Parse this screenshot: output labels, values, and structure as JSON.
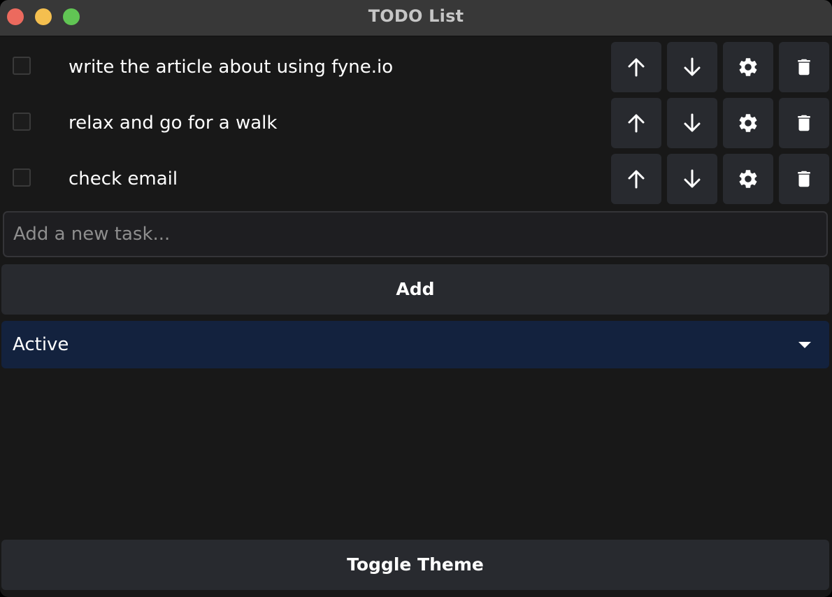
{
  "window": {
    "title": "TODO List"
  },
  "tasks": [
    {
      "label": "write the article about using fyne.io",
      "checked": false
    },
    {
      "label": "relax and go for a walk",
      "checked": false
    },
    {
      "label": "check email",
      "checked": false
    }
  ],
  "task_actions": {
    "icons": [
      "arrow-up-icon",
      "arrow-down-icon",
      "gear-icon",
      "trash-icon"
    ]
  },
  "new_task": {
    "placeholder": "Add a new task...",
    "value": ""
  },
  "add_button": {
    "label": "Add"
  },
  "filter": {
    "selected": "Active"
  },
  "toggle_theme_button": {
    "label": "Toggle Theme"
  },
  "colors": {
    "background": "#181818",
    "titlebar": "#383838",
    "button": "#282a2f",
    "select_background": "#13223e",
    "close": "#ec6a5e",
    "minimize": "#f4bf4f",
    "maximize": "#61c554"
  }
}
